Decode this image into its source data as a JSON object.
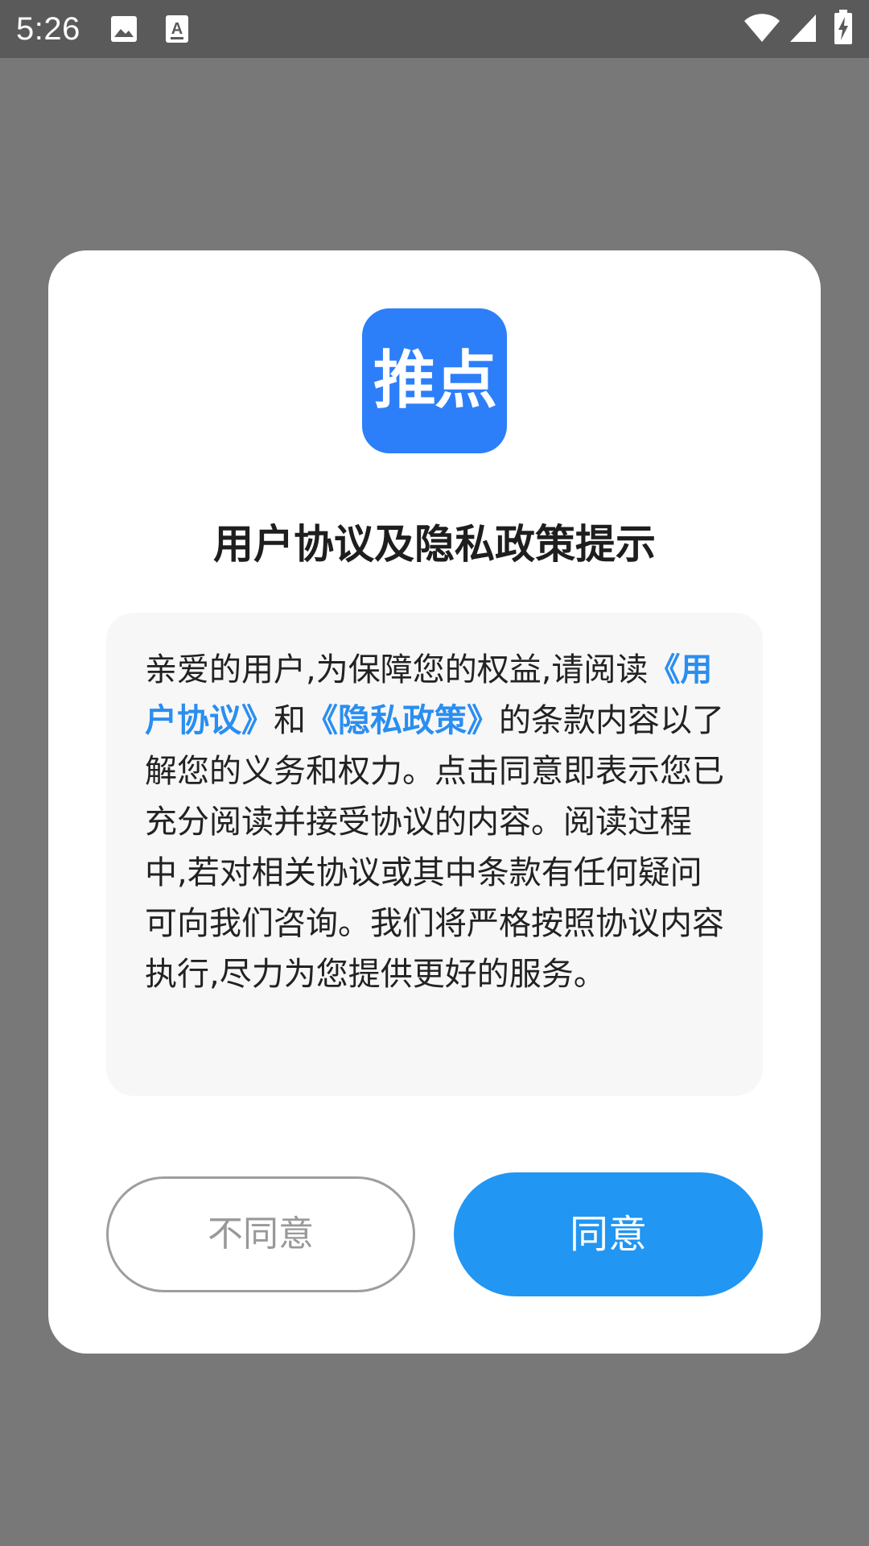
{
  "status_bar": {
    "time": "5:26",
    "icons": [
      "image-icon",
      "text-recognition-icon",
      "wifi-icon",
      "signal-icon",
      "battery-charging-icon"
    ]
  },
  "dialog": {
    "logo_text": "推点",
    "title": "用户协议及隐私政策提示",
    "body": {
      "intro": "亲爱的用户,为保障您的权益,请阅读",
      "user_agreement_link": "《用户协议》",
      "and": "和",
      "privacy_policy_link": "《隐私政策》",
      "rest": "的条款内容以了解您的义务和权力。点击同意即表示您已充分阅读并接受协议的内容。阅读过程中,若对相关协议或其中条款有任何疑问可向我们咨询。我们将严格按照协议内容执行,尽力为您提供更好的服务。"
    },
    "disagree_label": "不同意",
    "agree_label": "同意"
  },
  "colors": {
    "backdrop": "#787878",
    "status_bar": "#5a5a5a",
    "logo_bg": "#2d7ff9",
    "link": "#2a8ef0",
    "agree_button": "#2196f3",
    "disagree_border": "#9e9e9e"
  }
}
